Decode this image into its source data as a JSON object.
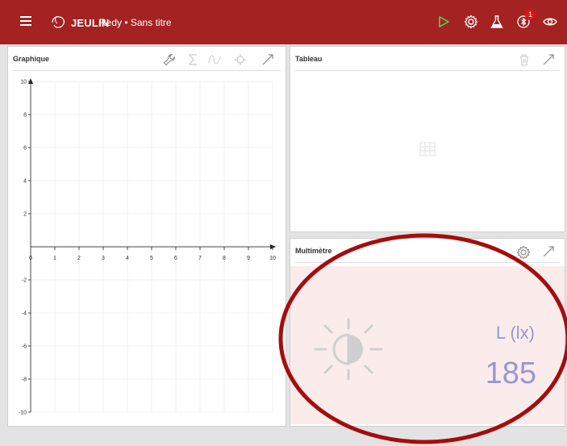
{
  "app": {
    "brand": "JEULIN",
    "title": "Redy • Sans titre"
  },
  "toolbar": {
    "icons": [
      "menu-icon",
      "play-icon",
      "settings-icon",
      "flask-icon",
      "bluetooth-icon",
      "eye-icon"
    ],
    "bluetooth_badge": "1",
    "accent_color": "#a52222",
    "play_color": "#4cd964"
  },
  "graph_panel": {
    "title": "Graphique",
    "tools": [
      "wrench-icon",
      "sum-icon",
      "curve-icon",
      "crosshair-icon",
      "expand-icon"
    ],
    "x_ticks": [
      "0",
      "1",
      "2",
      "3",
      "4",
      "5",
      "6",
      "7",
      "8",
      "9",
      "10"
    ],
    "y_ticks": [
      "10",
      "8",
      "6",
      "4",
      "2",
      "-2",
      "-4",
      "-6",
      "-8",
      "-10"
    ]
  },
  "table_panel": {
    "title": "Tableau",
    "tools": [
      "trash-icon",
      "expand-icon"
    ]
  },
  "multimeter_panel": {
    "title": "Multimètre",
    "tools": [
      "settings-icon",
      "expand-icon"
    ],
    "sensor_icon": "sun-icon",
    "quantity_label": "L (lx)",
    "value": "185",
    "value_color": "#9a96d2"
  }
}
